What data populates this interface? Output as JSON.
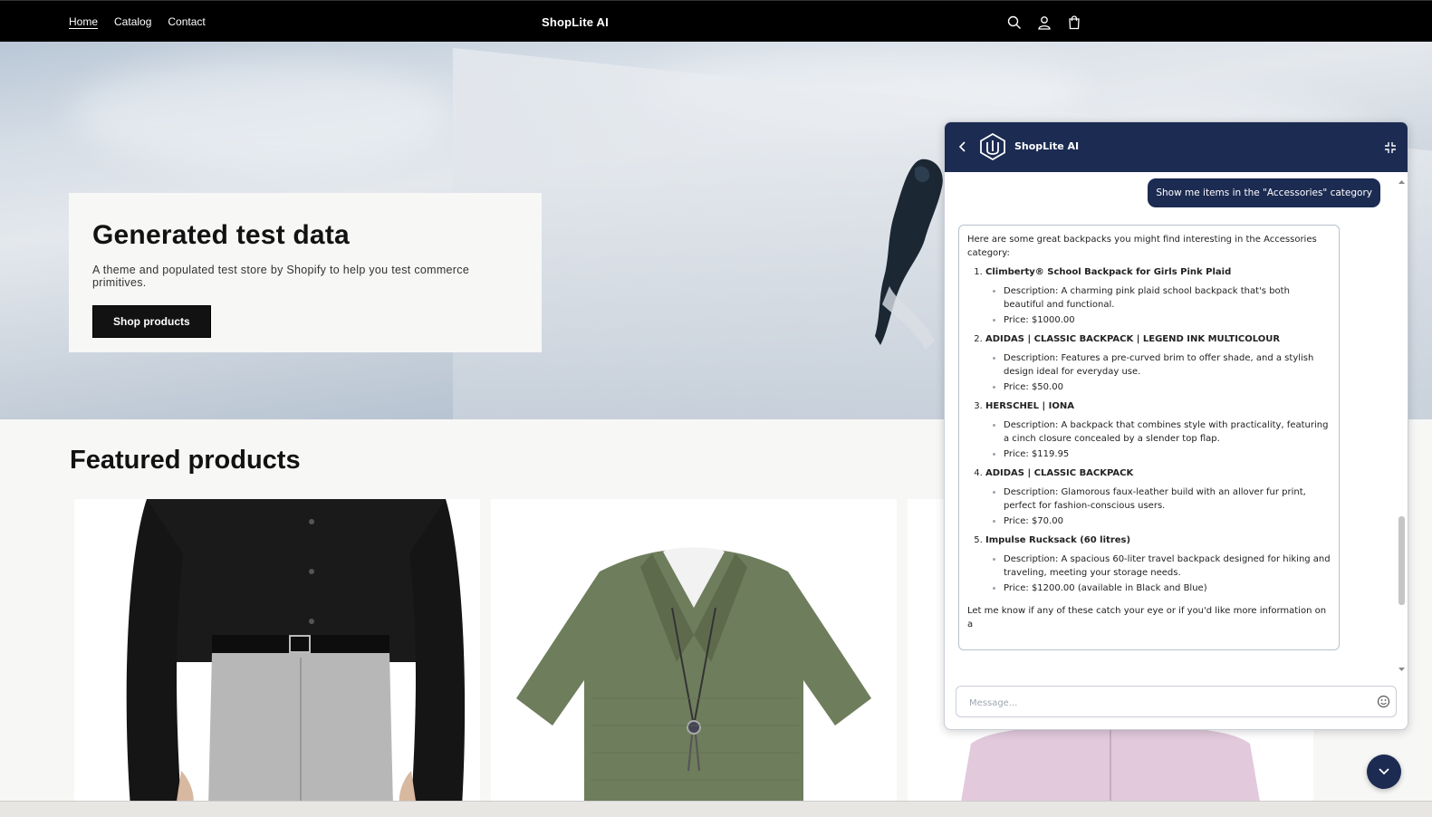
{
  "header": {
    "nav": [
      {
        "label": "Home",
        "active": true
      },
      {
        "label": "Catalog",
        "active": false
      },
      {
        "label": "Contact",
        "active": false
      }
    ],
    "brand": "ShopLite AI",
    "icons": [
      "search-icon",
      "account-icon",
      "cart-icon"
    ]
  },
  "hero": {
    "title": "Generated test data",
    "subtitle": "A theme and populated test store by Shopify to help you test commerce primitives.",
    "button": "Shop products"
  },
  "featured": {
    "title": "Featured products"
  },
  "chat": {
    "title": "ShopLite AI",
    "user_message": "Show me items in the \"Accessories\" category",
    "bot_intro": "Here are some great backpacks you might find interesting in the Accessories category:",
    "items": [
      {
        "name": "Climberty® School Backpack for Girls Pink Plaid",
        "description": "Description: A charming pink plaid school backpack that's both beautiful and functional.",
        "price": "Price: $1000.00"
      },
      {
        "name": "ADIDAS | CLASSIC BACKPACK | LEGEND INK MULTICOLOUR",
        "description": "Description: Features a pre-curved brim to offer shade, and a stylish design ideal for everyday use.",
        "price": "Price: $50.00"
      },
      {
        "name": "HERSCHEL | IONA",
        "description": "Description: A backpack that combines style with practicality, featuring a cinch closure concealed by a slender top flap.",
        "price": "Price: $119.95"
      },
      {
        "name": "ADIDAS | CLASSIC BACKPACK",
        "description": "Description: Glamorous faux-leather build with an allover fur print, perfect for fashion-conscious users.",
        "price": "Price: $70.00"
      },
      {
        "name": "Impulse Rucksack (60 litres)",
        "description": "Description: A spacious 60-liter travel backpack designed for hiking and traveling, meeting your storage needs.",
        "price": "Price: $1200.00 (available in Black and Blue)"
      }
    ],
    "bot_closing": "Let me know if any of these catch your eye or if you'd like more information on a",
    "input_placeholder": "Message...",
    "accent_color": "#1c2b52"
  }
}
